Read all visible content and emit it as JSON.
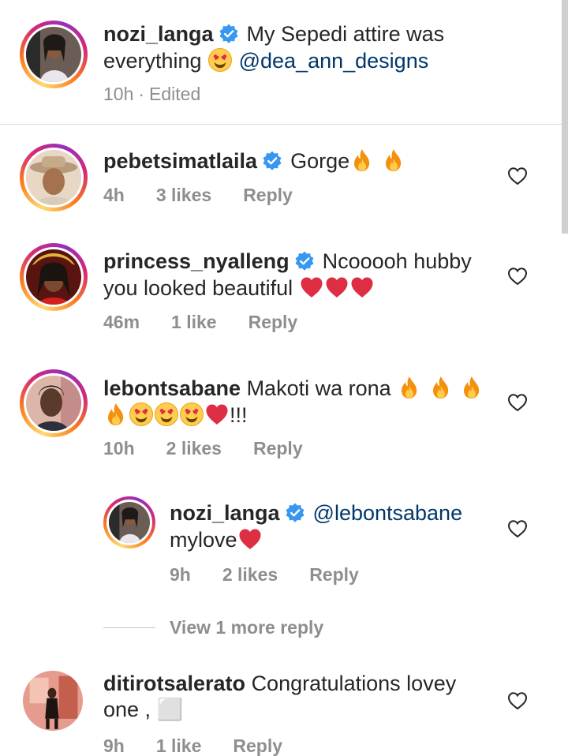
{
  "caption": {
    "username": "nozi_langa",
    "text_before": "My Sepedi attire was everything",
    "mention": "@dea_ann_designs",
    "time": "10h",
    "separator": "·",
    "edited": "Edited"
  },
  "comments": [
    {
      "username": "pebetsimatlaila",
      "text": "Gorge",
      "time": "4h",
      "likes": "3 likes",
      "reply": "Reply"
    },
    {
      "username": "princess_nyalleng",
      "text_line1": "Ncooooh hubby",
      "text_line2": "you looked beautiful",
      "time": "46m",
      "likes": "1 like",
      "reply": "Reply"
    },
    {
      "username": "lebontsabane",
      "text": "Makoti wa rona",
      "text_end": "!!!",
      "time": "10h",
      "likes": "2 likes",
      "reply": "Reply"
    },
    {
      "username": "nozi_langa",
      "mention": "@lebontsabane",
      "text": "mylove",
      "time": "9h",
      "likes": "2 likes",
      "reply": "Reply"
    },
    {
      "username": "ditirotsalerato",
      "text_line1": "Congratulations lovey",
      "text_line2": "one , ⬜",
      "time": "9h",
      "likes": "1 like",
      "reply": "Reply"
    }
  ],
  "view_more_replies": "View 1 more reply",
  "icons": {
    "verified": "verified-badge-icon",
    "heart": "heart-outline-icon",
    "fire": "fire-emoji",
    "heart_eyes": "heart-eyes-emoji",
    "red_heart": "red-heart-emoji"
  },
  "colors": {
    "verified": "#3897f0",
    "mention": "#00376b",
    "meta": "#8e8e8e",
    "divider": "#dbdbdb"
  }
}
